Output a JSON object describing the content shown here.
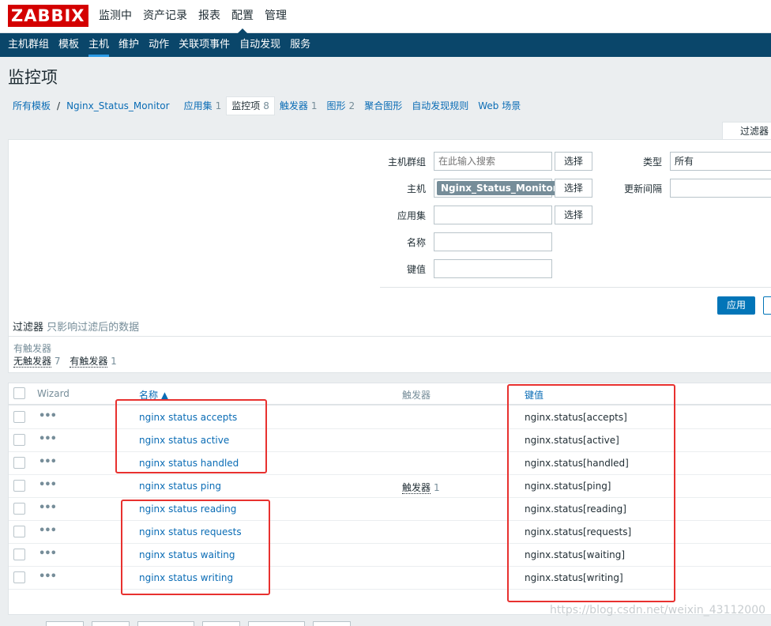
{
  "top_menu": {
    "logo": "ZABBIX",
    "items": [
      "监测中",
      "资产记录",
      "报表",
      "配置",
      "管理"
    ]
  },
  "sub_menu": {
    "items": [
      "主机群组",
      "模板",
      "主机",
      "维护",
      "动作",
      "关联项事件",
      "自动发现",
      "服务"
    ]
  },
  "page_title": "监控项",
  "breadcrumb": {
    "all_templates": "所有模板",
    "separator": "/",
    "template": "Nginx_Status_Monitor",
    "apps": "应用集",
    "apps_count": "1",
    "items": "监控项",
    "items_count": "8",
    "triggers": "触发器",
    "triggers_count": "1",
    "graphs": "图形",
    "graphs_count": "2",
    "screens": "聚合图形",
    "discovery": "自动发现规则",
    "web": "Web 场景"
  },
  "filter": {
    "tab_label": "过滤器",
    "host_group_label": "主机群组",
    "host_group_placeholder": "在此输入搜索",
    "select_label": "选择",
    "host_label": "主机",
    "host_value": "Nginx_Status_Monitor",
    "chip_close": "✖",
    "app_label": "应用集",
    "name_label": "名称",
    "key_label": "键值",
    "type_label": "类型",
    "type_value": "所有",
    "interval_label": "更新间隔",
    "apply_label": "应用",
    "note_title": "过滤器",
    "note_sub": "只影响过滤后的数据"
  },
  "trigger_filter": {
    "title": "有触发器",
    "without_label": "无触发器",
    "without_count": "7",
    "with_label": "有触发器",
    "with_count": "1"
  },
  "table": {
    "headers": {
      "wizard": "Wizard",
      "name": "名称 ▲",
      "triggers": "触发器",
      "key": "键值"
    },
    "rows": [
      {
        "name": "nginx status accepts",
        "key": "nginx.status[accepts]",
        "trigger": "",
        "trigger_count": ""
      },
      {
        "name": "nginx status active",
        "key": "nginx.status[active]",
        "trigger": "",
        "trigger_count": ""
      },
      {
        "name": "nginx status handled",
        "key": "nginx.status[handled]",
        "trigger": "",
        "trigger_count": ""
      },
      {
        "name": "nginx status ping",
        "key": "nginx.status[ping]",
        "trigger": "触发器",
        "trigger_count": "1"
      },
      {
        "name": "nginx status reading",
        "key": "nginx.status[reading]",
        "trigger": "",
        "trigger_count": ""
      },
      {
        "name": "nginx status requests",
        "key": "nginx.status[requests]",
        "trigger": "",
        "trigger_count": ""
      },
      {
        "name": "nginx status waiting",
        "key": "nginx.status[waiting]",
        "trigger": "",
        "trigger_count": ""
      },
      {
        "name": "nginx status writing",
        "key": "nginx.status[writing]",
        "trigger": "",
        "trigger_count": ""
      }
    ],
    "row_menu_glyph": "•••"
  },
  "watermark": "https://blog.csdn.net/weixin_43112000",
  "colors": {
    "brand_red": "#d40000",
    "nav_blue": "#0a466a",
    "link_blue": "#0a6cb5",
    "annotation_red": "#e8312f"
  }
}
